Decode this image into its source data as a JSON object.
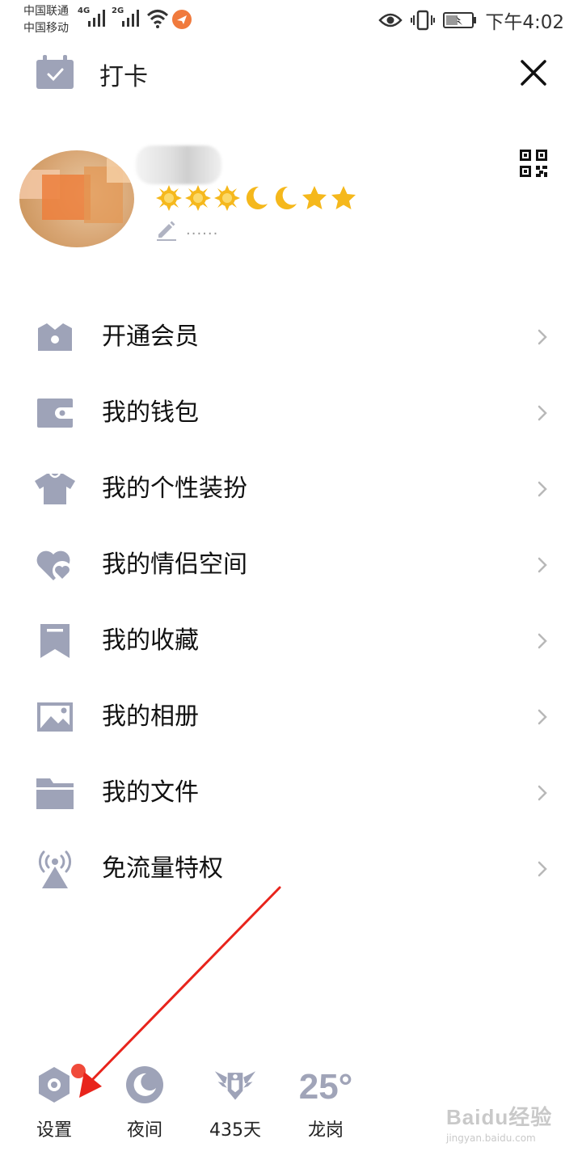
{
  "status_bar": {
    "carrier_1": "中国联通",
    "carrier_2": "中国移动",
    "network_1": "4G",
    "network_2": "2G",
    "time": "下午4:02"
  },
  "header": {
    "title": "打卡",
    "checkin_icon": "calendar-check-icon",
    "close_icon": "close-icon"
  },
  "profile": {
    "level_icons": [
      "sun-icon",
      "sun-icon",
      "sun-icon",
      "moon-icon",
      "moon-icon",
      "star-icon",
      "star-icon"
    ],
    "signature": "......",
    "qr_icon": "qr-code-icon"
  },
  "menu": {
    "items": [
      {
        "label": "开通会员",
        "icon": "crown-icon"
      },
      {
        "label": "我的钱包",
        "icon": "wallet-icon"
      },
      {
        "label": "我的个性装扮",
        "icon": "shirt-icon"
      },
      {
        "label": "我的情侣空间",
        "icon": "couple-heart-icon"
      },
      {
        "label": "我的收藏",
        "icon": "bookmark-icon"
      },
      {
        "label": "我的相册",
        "icon": "photo-icon"
      },
      {
        "label": "我的文件",
        "icon": "folder-icon"
      },
      {
        "label": "免流量特权",
        "icon": "antenna-icon"
      }
    ]
  },
  "bottom_bar": {
    "settings_label": "设置",
    "night_label": "夜间",
    "days_label": "435天",
    "weather_temp": "25°",
    "location_label": "龙岗"
  },
  "watermark": {
    "main": "Baidu经验",
    "sub": "jingyan.baidu.com"
  },
  "colors": {
    "icon_gray": "#9ea3b8",
    "badge_red": "#f04a3a",
    "annotation_red": "#e8241c"
  }
}
